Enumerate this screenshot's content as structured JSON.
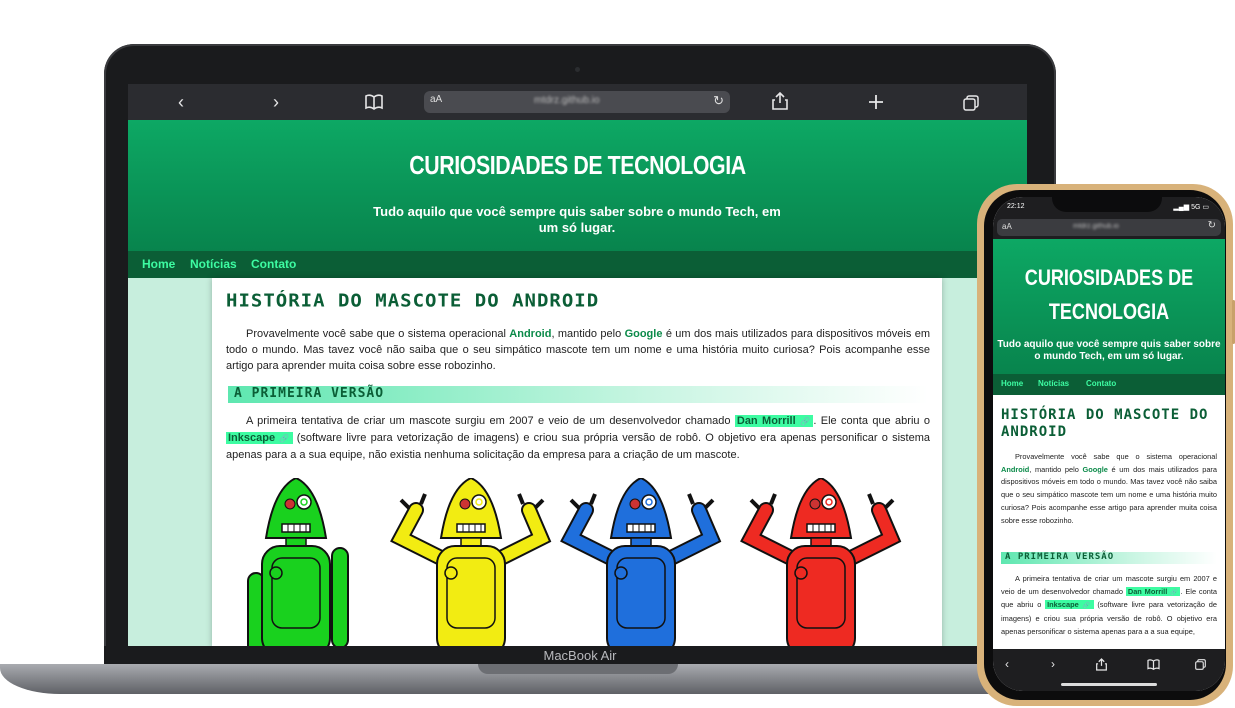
{
  "browser": {
    "text_size": "aA",
    "url": "mtdrz.github.io",
    "back_icon": "‹",
    "forward_icon": "›",
    "reload_icon": "↻"
  },
  "site": {
    "title": "CURIOSIDADES DE TECNOLOGIA",
    "subtitle": "Tudo aquilo que você sempre quis saber sobre o mundo Tech, em um só lugar.",
    "nav": [
      "Home",
      "Notícias",
      "Contato"
    ]
  },
  "article": {
    "title": "HISTÓRIA DO MASCOTE DO ANDROID",
    "intro_before_android": "Provavelmente você sabe que o sistema operacional ",
    "android": "Android",
    "intro_mid": ", mantido pelo ",
    "google": "Google",
    "intro_after": " é um dos mais utilizados para dispositivos móveis em todo o mundo. Mas tavez você não saiba que o seu simpático mascote tem um nome e uma história muito curiosa? Pois acompanhe esse artigo para aprender muita coisa sobre esse robozinho.",
    "section_title": "A PRIMEIRA VERSÃO",
    "p2_before": "A primeira tentativa de criar um mascote surgiu em 2007 e veio de um desenvolvedor chamado ",
    "dan": "Dan Morrill",
    "p2_mid": ". Ele conta que abriu o ",
    "inkscape": "Inkscape",
    "p2_after": " (software livre para vetorização de imagens) e criou sua própria versão de robô. O objetivo era apenas personificar o sistema apenas para a a sua equipe, não existia nenhuma solicitação da empresa para a criação de um mascote.",
    "p2_after_phone": " (software livre para vetorização de imagens) e criou sua própria versão de robô. O objetivo era apenas personificar o sistema apenas para a a sua equipe,",
    "link_icon": "🔗"
  },
  "device": {
    "laptop_label": "MacBook Air",
    "phone_time": "22:12",
    "phone_signal": "5G"
  },
  "robots": {
    "colors": [
      "#19d11e",
      "#f2ec12",
      "#1f6fdc",
      "#ee2a22"
    ]
  }
}
